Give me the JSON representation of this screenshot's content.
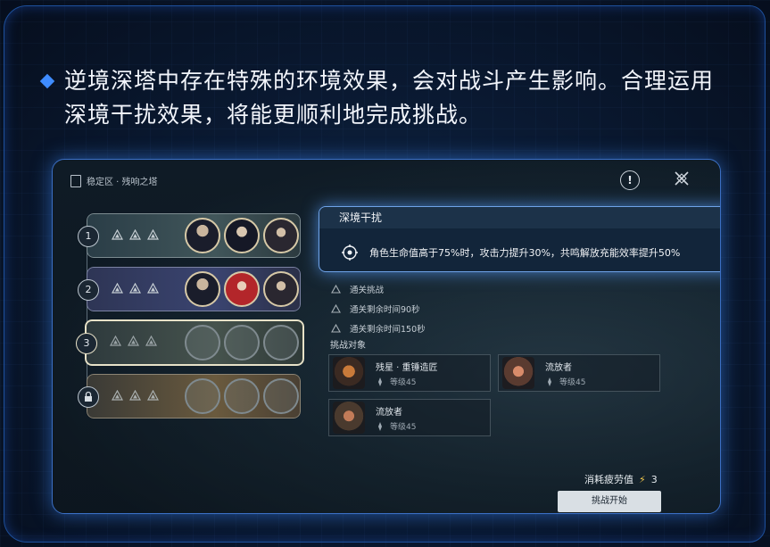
{
  "intro": {
    "line1": "逆境深塔中存在特殊的环境效果，会对战斗产生影响。合理运用",
    "line2": "深境干扰效果，将能更顺利地完成挑战。",
    "bullet_color": "#3f8cff"
  },
  "game": {
    "breadcrumb": "稳定区 · 残响之塔",
    "alert_label": "!",
    "close_label": "✕",
    "floors": [
      {
        "number": "1",
        "triangles": 3,
        "team": [
          "dark-haired hero portrait",
          "dark-haired hero portrait",
          "hooded hero portrait"
        ],
        "locked": false
      },
      {
        "number": "2",
        "triangles": 3,
        "team": [
          "dark-haired hero portrait",
          "red-haired hero portrait",
          "hooded hero portrait"
        ],
        "locked": false
      },
      {
        "number": "3",
        "triangles": 3,
        "team": [
          "empty slot",
          "empty slot",
          "empty slot"
        ],
        "locked": false,
        "selected": true
      },
      {
        "number": "",
        "triangles": 3,
        "team": [
          "empty slot",
          "empty slot",
          "empty slot"
        ],
        "locked": true
      }
    ],
    "tooltip": {
      "title": "深境干扰",
      "text": "角色生命值高于75%时，攻击力提升30%，共鸣解放充能效率提升50%"
    },
    "objectives": [
      "通关挑战",
      "通关剩余时间90秒",
      "通关剩余时间150秒"
    ],
    "challenge_title": "挑战对象",
    "enemies": [
      {
        "name": "残星 · 重锤造匠",
        "level": "等级45"
      },
      {
        "name": "流放者",
        "level": "等级45"
      },
      {
        "name": "流放者",
        "level": "等级45"
      }
    ],
    "cost_label": "消耗疲劳值",
    "cost_value": "3",
    "start_button": "挑战开始"
  }
}
